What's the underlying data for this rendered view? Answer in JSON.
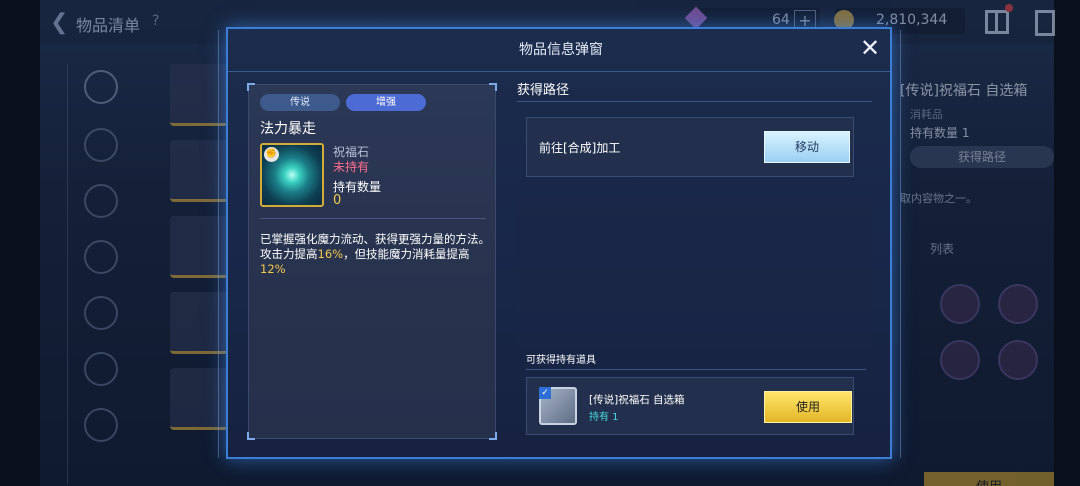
{
  "background": {
    "title": "物品清单",
    "help": "?",
    "gem_amount": "64",
    "plus": "+",
    "coin_amount": "2,810,344",
    "right_panel": {
      "title": "[传说]祝福石 自选箱",
      "subtitle": "消耗品",
      "hold": "持有数量 1",
      "route_button": "获得路径",
      "desc": "取内容物之一。",
      "list": "列表",
      "use": "使用"
    }
  },
  "popup": {
    "title": "物品信息弹窗",
    "close": "✕",
    "card": {
      "tag_grade": "传说",
      "tag_type": "增强",
      "skill_name": "法力暴走",
      "item_name": "祝福石",
      "owned_status": "未持有",
      "qty_label": "持有数量",
      "qty_value": "0",
      "desc_line1": "已掌握强化魔力流动、获得更强力量的方法。",
      "desc_line2_a": "攻击力提高",
      "desc_line2_b": "16%",
      "desc_line2_c": "，但技能魔力消耗量提高",
      "desc_line2_d": "12%"
    },
    "route": {
      "title": "获得路径",
      "entry": "前往[合成]加工",
      "move_button": "移动"
    },
    "owned": {
      "title": "可获得持有道具",
      "item_name": "[传说]祝福石 自选箱",
      "item_count": "持有 1",
      "use_button": "使用"
    }
  },
  "colors": {
    "accent_blue": "#3c7dd6",
    "highlight": "#f2c94c",
    "not_owned": "#ff6e8d",
    "count_cyan": "#48d7e0"
  }
}
